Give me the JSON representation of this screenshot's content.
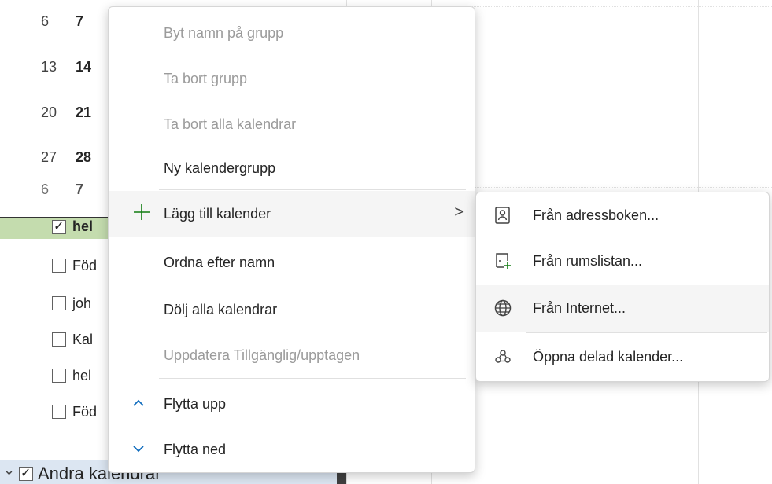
{
  "mini_calendar": {
    "rows": [
      {
        "d1": "6",
        "d2": "7"
      },
      {
        "d1": "13",
        "d2": "14"
      },
      {
        "d1": "20",
        "d2": "21"
      },
      {
        "d1": "27",
        "d2": "28"
      },
      {
        "d1": "6",
        "d2": "7"
      }
    ]
  },
  "calendar_list": {
    "items": [
      {
        "label": "hel",
        "checked": true
      },
      {
        "label": "Föd",
        "checked": false
      },
      {
        "label": "joh",
        "checked": false
      },
      {
        "label": "Kal",
        "checked": false
      },
      {
        "label": "hel",
        "checked": false
      },
      {
        "label": "Föd",
        "checked": false
      }
    ],
    "group": {
      "label": "Andra kalendrar",
      "chevron": "chevron-down-icon"
    }
  },
  "context_menu": {
    "items": [
      {
        "label": "Byt namn på grupp",
        "disabled": true,
        "mnemonic": "B"
      },
      {
        "label": "Ta bort grupp",
        "disabled": true,
        "mnemonic": "T"
      },
      {
        "label": "Ta bort alla kalendrar",
        "disabled": true,
        "mnemonic": "k"
      },
      {
        "label": "Ny kalendergrupp",
        "disabled": false,
        "mnemonic": "N"
      },
      {
        "label": "Lägg till kalender",
        "disabled": false,
        "icon": "plus-icon",
        "submenu": true,
        "arrow": ">"
      },
      {
        "label": "Ordna efter namn",
        "disabled": false,
        "mnemonic": "O"
      },
      {
        "label": "Dölj alla kalendrar",
        "disabled": false,
        "mnemonic": "D"
      },
      {
        "label": "Uppdatera Tillgänglig/upptagen",
        "disabled": true,
        "mnemonic": "a"
      },
      {
        "label": "Flytta upp",
        "disabled": false,
        "icon": "chevron-up-icon",
        "mnemonic": "F"
      },
      {
        "label": "Flytta ned",
        "disabled": false,
        "icon": "chevron-down-icon",
        "mnemonic": "l"
      }
    ]
  },
  "submenu": {
    "items": [
      {
        "label": "Från adressboken...",
        "icon": "address-book-icon"
      },
      {
        "label": "Från rumslistan...",
        "icon": "room-list-icon"
      },
      {
        "label": "Från Internet...",
        "icon": "globe-icon"
      },
      {
        "label": "Öppna delad kalender...",
        "icon": "shared-calendar-icon"
      }
    ]
  },
  "colors": {
    "accent_green": "#107c10",
    "accent_blue": "#0f6cbd",
    "selected_row": "#c4dcae",
    "disabled_text": "#9b9b9b"
  }
}
